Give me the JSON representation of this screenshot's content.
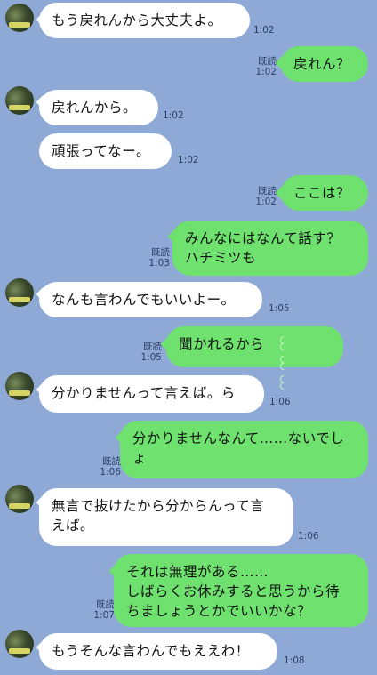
{
  "colors": {
    "background": "#8fa9d6",
    "incoming": "#ffffff",
    "outgoing": "#6ee16e"
  },
  "messages": [
    {
      "side": "in",
      "text": "もう戻れんから大丈夫よ。",
      "time": "1:02",
      "avatar": true
    },
    {
      "side": "out",
      "text": "戻れん？",
      "read": "既読",
      "time": "1:02"
    },
    {
      "side": "in",
      "text": "戻れんから。",
      "time": "1:02",
      "avatar": true
    },
    {
      "side": "in",
      "text": "頑張ってなー。",
      "time": "1:02",
      "avatar": false
    },
    {
      "side": "out",
      "text": "ここは？",
      "read": "既読",
      "time": "1:02"
    },
    {
      "side": "out",
      "text": "みんなにはなんて話す？\nハチミツも",
      "read": "既読",
      "time": "1:03"
    },
    {
      "side": "in",
      "text": "なんも言わんでもいいよー。",
      "time": "1:05",
      "avatar": true
    },
    {
      "side": "out",
      "text": "聞かれるから",
      "read": "既読",
      "time": "1:05"
    },
    {
      "side": "in",
      "text": "分かりませんって言えば。ら",
      "time": "1:06",
      "avatar": true
    },
    {
      "side": "out",
      "text": "分かりませんなんて……ないでし\nょ",
      "read": "既読",
      "time": "1:06"
    },
    {
      "side": "in",
      "text": "無言で抜けたから分からんって言\nえば。",
      "time": "1:06",
      "avatar": true
    },
    {
      "side": "out",
      "text": "それは無理がある……\nしばらくお休みすると思うから待\nちましょうとかでいいかな？",
      "read": "既読",
      "time": "1:07"
    },
    {
      "side": "in",
      "text": "もうそんな言わんでもええわ！",
      "time": "1:08",
      "avatar": true
    }
  ]
}
